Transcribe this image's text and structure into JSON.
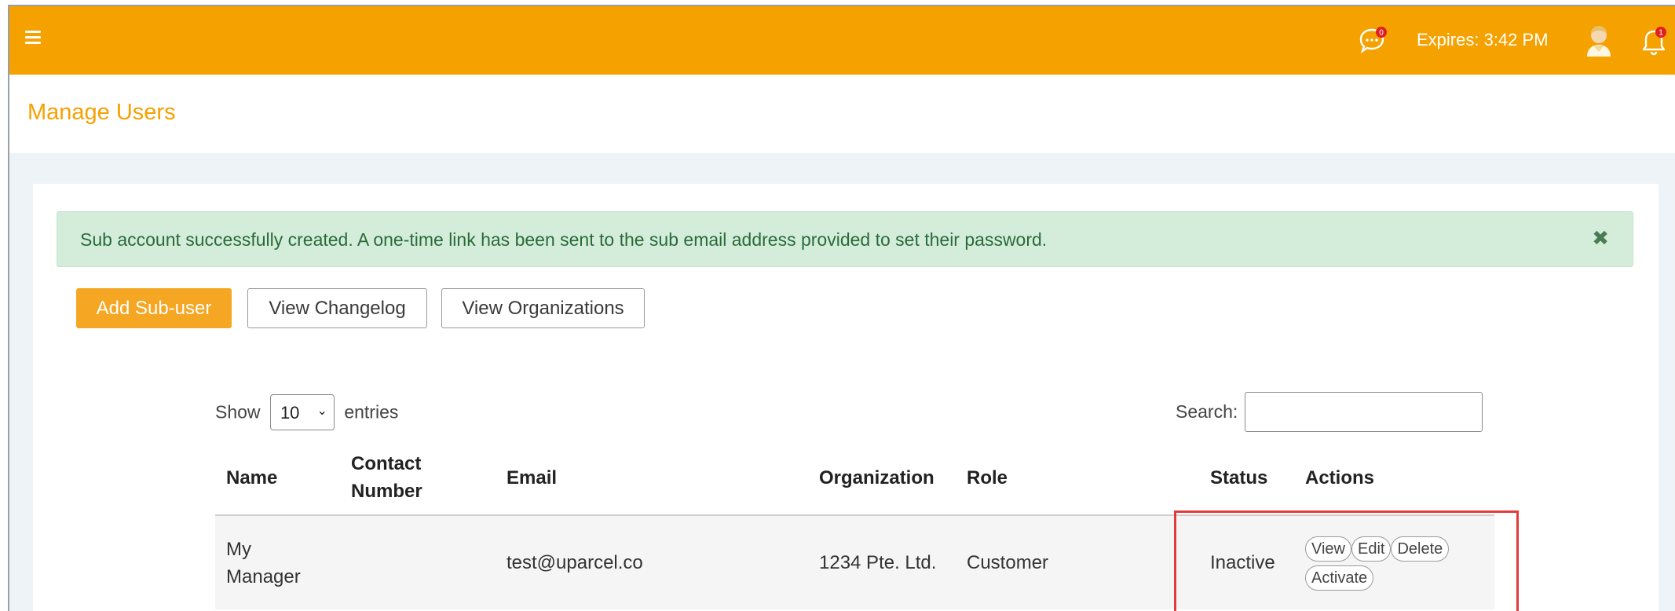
{
  "header": {
    "chat_badge": "0",
    "expires": "Expires: 3:42 PM",
    "bell_badge": "1",
    "brand_color": "#f5a100"
  },
  "page": {
    "title": "Manage Users"
  },
  "alert": {
    "message": "Sub account successfully created. A one-time link has been sent to the sub email address provided to set their password.",
    "close": "✖"
  },
  "toolbar": {
    "add_label": "Add Sub-user",
    "changelog_label": "View Changelog",
    "orgs_label": "View Organizations"
  },
  "table_controls": {
    "show_label": "Show",
    "entries_value": "10",
    "entries_label": "entries",
    "search_label": "Search:",
    "search_value": ""
  },
  "table": {
    "columns": [
      "Name",
      "Contact Number",
      "Email",
      "Organization",
      "Role",
      "Status",
      "Actions"
    ],
    "rows": [
      {
        "name": "My Manager",
        "contact": "",
        "email": "test@uparcel.co",
        "organization": "1234 Pte. Ltd.",
        "role": "Customer",
        "status": "Inactive",
        "actions": [
          "View",
          "Edit",
          "Delete",
          "Activate"
        ]
      }
    ]
  },
  "icons": {
    "menu": "hamburger-icon",
    "chat": "chat-bubble-icon",
    "avatar": "user-avatar-icon",
    "bell": "bell-icon"
  }
}
